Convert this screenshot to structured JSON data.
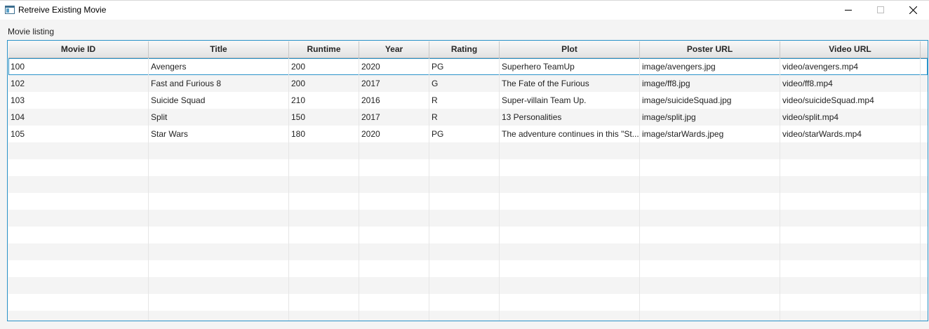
{
  "window": {
    "title": "Retreive Existing Movie"
  },
  "section_label": "Movie listing",
  "table": {
    "columns": [
      "Movie ID",
      "Title",
      "Runtime",
      "Year",
      "Rating",
      "Plot",
      "Poster URL",
      "Video URL"
    ],
    "rows": [
      [
        "100",
        "Avengers",
        "200",
        "2020",
        "PG",
        "Superhero TeamUp",
        "image/avengers.jpg",
        "video/avengers.mp4"
      ],
      [
        "102",
        "Fast and Furious 8",
        "200",
        "2017",
        "G",
        "The Fate of the Furious",
        "image/ff8.jpg",
        "video/ff8.mp4"
      ],
      [
        "103",
        "Suicide Squad",
        "210",
        "2016",
        "R",
        "Super-villain Team Up.",
        "image/suicideSquad.jpg",
        "video/suicideSquad.mp4"
      ],
      [
        "104",
        "Split",
        "150",
        "2017",
        "R",
        "13 Personalities",
        "image/split.jpg",
        "video/split.mp4"
      ],
      [
        "105",
        "Star Wars",
        "180",
        "2020",
        "PG",
        "The adventure continues in this \"St...",
        "image/starWards.jpeg",
        "video/starWards.mp4"
      ]
    ],
    "selected_row": 0
  },
  "colors": {
    "accent": "#2a93c9",
    "row_alt": "#f4f4f4"
  },
  "icons": {
    "app": "app-window-icon",
    "minimize": "minimize-icon",
    "maximize": "maximize-icon",
    "close": "close-icon"
  }
}
